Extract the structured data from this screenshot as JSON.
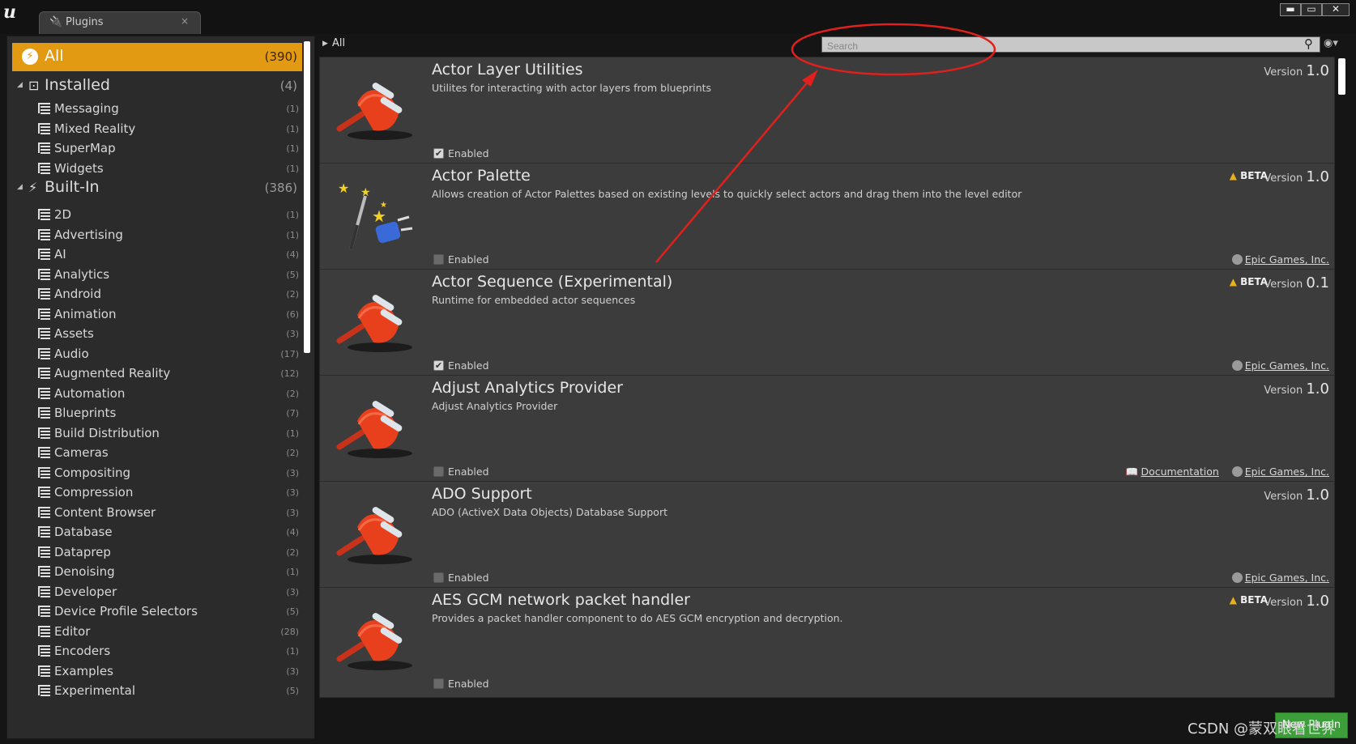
{
  "window": {
    "tab_icon": "plug-icon",
    "tab_title": "Plugins",
    "tab_close": "×",
    "minimize": "▬",
    "maximize": "▭",
    "close": "✕"
  },
  "sidebar": {
    "all": {
      "label": "All",
      "count": "(390)"
    },
    "installed": {
      "label": "Installed",
      "count": "(4)"
    },
    "installed_items": [
      {
        "label": "Messaging",
        "count": "(1)"
      },
      {
        "label": "Mixed Reality",
        "count": "(1)"
      },
      {
        "label": "SuperMap",
        "count": "(1)"
      },
      {
        "label": "Widgets",
        "count": "(1)"
      }
    ],
    "builtin": {
      "label": "Built-In",
      "count": "(386)"
    },
    "builtin_items": [
      {
        "label": "2D",
        "count": "(1)"
      },
      {
        "label": "Advertising",
        "count": "(1)"
      },
      {
        "label": "AI",
        "count": "(4)"
      },
      {
        "label": "Analytics",
        "count": "(5)"
      },
      {
        "label": "Android",
        "count": "(2)"
      },
      {
        "label": "Animation",
        "count": "(6)"
      },
      {
        "label": "Assets",
        "count": "(3)"
      },
      {
        "label": "Audio",
        "count": "(17)"
      },
      {
        "label": "Augmented Reality",
        "count": "(12)"
      },
      {
        "label": "Automation",
        "count": "(2)"
      },
      {
        "label": "Blueprints",
        "count": "(7)"
      },
      {
        "label": "Build Distribution",
        "count": "(1)"
      },
      {
        "label": "Cameras",
        "count": "(2)"
      },
      {
        "label": "Compositing",
        "count": "(3)"
      },
      {
        "label": "Compression",
        "count": "(3)"
      },
      {
        "label": "Content Browser",
        "count": "(3)"
      },
      {
        "label": "Database",
        "count": "(4)"
      },
      {
        "label": "Dataprep",
        "count": "(2)"
      },
      {
        "label": "Denoising",
        "count": "(1)"
      },
      {
        "label": "Developer",
        "count": "(3)"
      },
      {
        "label": "Device Profile Selectors",
        "count": "(5)"
      },
      {
        "label": "Editor",
        "count": "(28)"
      },
      {
        "label": "Encoders",
        "count": "(1)"
      },
      {
        "label": "Examples",
        "count": "(3)"
      },
      {
        "label": "Experimental",
        "count": "(5)"
      }
    ]
  },
  "breadcrumb": {
    "label": "All"
  },
  "search": {
    "placeholder": "Search"
  },
  "plugins": [
    {
      "title": "Actor Layer Utilities",
      "desc": "Utilites for interacting with actor layers from blueprints",
      "enabled": true,
      "enabled_label": "Enabled",
      "beta": "",
      "version_label": "Version",
      "version": "1.0",
      "doc": "",
      "author": "",
      "icon": "plug-icon"
    },
    {
      "title": "Actor Palette",
      "desc": "Allows creation of Actor Palettes based on existing levels to quickly select actors and drag them into the level editor",
      "enabled": false,
      "enabled_label": "Enabled",
      "beta": "BETA",
      "version_label": "Version",
      "version": "1.0",
      "doc": "",
      "author": "Epic Games, Inc.",
      "icon": "magic-wand-icon"
    },
    {
      "title": "Actor Sequence (Experimental)",
      "desc": "Runtime for embedded actor sequences",
      "enabled": true,
      "enabled_label": "Enabled",
      "beta": "BETA",
      "version_label": "Version",
      "version": "0.1",
      "doc": "",
      "author": "Epic Games, Inc.",
      "icon": "plug-icon"
    },
    {
      "title": "Adjust Analytics Provider",
      "desc": "Adjust Analytics Provider",
      "enabled": false,
      "enabled_label": "Enabled",
      "beta": "",
      "version_label": "Version",
      "version": "1.0",
      "doc": "Documentation",
      "author": "Epic Games, Inc.",
      "icon": "plug-icon"
    },
    {
      "title": "ADO Support",
      "desc": "ADO (ActiveX Data Objects) Database Support",
      "enabled": false,
      "enabled_label": "Enabled",
      "beta": "",
      "version_label": "Version",
      "version": "1.0",
      "doc": "",
      "author": "Epic Games, Inc.",
      "icon": "plug-icon"
    },
    {
      "title": "AES GCM network packet handler",
      "desc": "Provides a packet handler component to do AES GCM encryption and decryption.",
      "enabled": false,
      "enabled_label": "Enabled",
      "beta": "BETA",
      "version_label": "Version",
      "version": "1.0",
      "doc": "",
      "author": "",
      "icon": "plug-icon"
    }
  ],
  "new_plugin": "New Plugin",
  "watermark": "CSDN @蒙双眼看世界",
  "colors": {
    "accent": "#e29a12",
    "new_plugin": "#3b9e39",
    "plug": "#e8401c",
    "annotation": "#e0201c"
  }
}
